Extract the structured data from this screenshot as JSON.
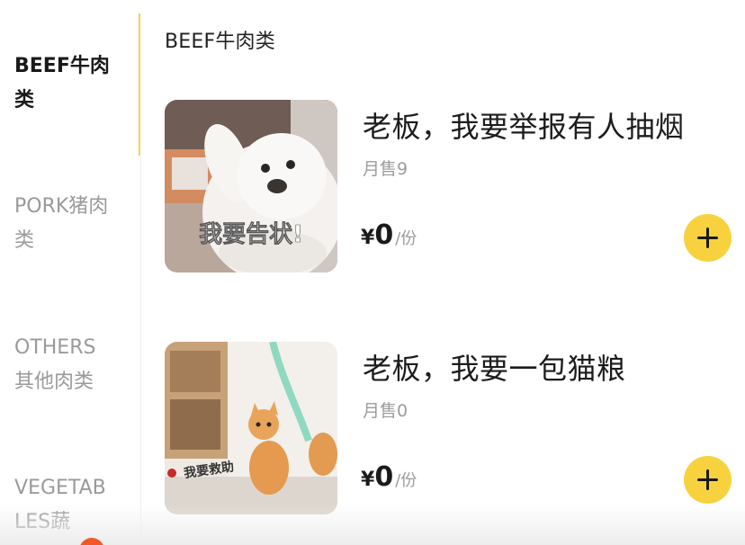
{
  "sidebar": {
    "categories": [
      {
        "label": "BEEF牛肉类",
        "active": true
      },
      {
        "label": "PORK猪肉类",
        "active": false
      },
      {
        "label": "OTHERS其他肉类",
        "active": false
      },
      {
        "label": "VEGETABLES蔬",
        "active": false
      }
    ],
    "accent_color": "#f5d54a"
  },
  "section": {
    "title": "BEEF牛肉类"
  },
  "items": [
    {
      "name": "老板，我要举报有人抽烟",
      "sales": "月售9",
      "currency": "¥",
      "price": "0",
      "unit": "/份",
      "image_caption": "我要告状!",
      "image_icon": "puppy-meme-image"
    },
    {
      "name": "老板，我要一包猫粮",
      "sales": "月售0",
      "currency": "¥",
      "price": "0",
      "unit": "/份",
      "image_caption": "我要救助",
      "image_icon": "cat-meme-image"
    }
  ],
  "colors": {
    "add_button": "#f7d23e",
    "badge": "#f05a28"
  }
}
